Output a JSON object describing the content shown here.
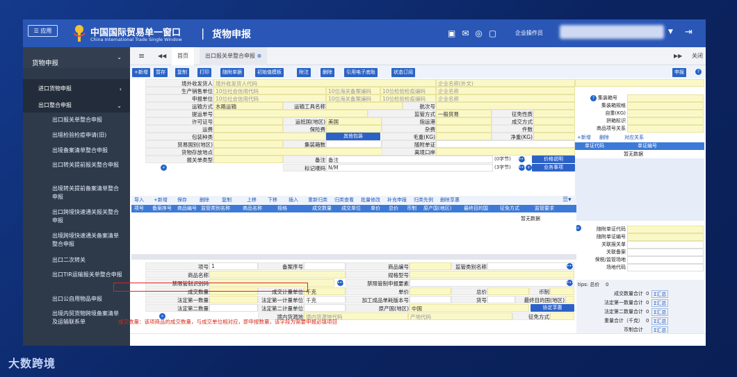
{
  "app": {
    "button": "应用",
    "title_cn": "中国国际贸易单一窗口",
    "title_en": "China International Trade Single Window",
    "module": "货物申报",
    "user_role": "企业操作员",
    "colors": {
      "header": "#2a57b6",
      "sidebar": "#2e3a4a",
      "field_yellow": "#fbf8c8",
      "accent_blue": "#2a63c6"
    }
  },
  "sidebar": {
    "top": "货物申报",
    "groups": [
      {
        "label": "进口货物申报"
      },
      {
        "label": "出口整合申报"
      }
    ],
    "items": [
      "出口报关单整合申报",
      "出境检验检疫申请(旧)",
      "出境备案清单整合申报",
      "出口转关提前报关整合申报",
      "出境转关提前备案清单整合申报",
      "出口跨境快速通关报关整合申报",
      "出境跨境快速通关备案清单整合申报",
      "出口二次转关",
      "出口TIR运输报关单整合申报",
      "出口公自用物品申报",
      "出境内贸货物跨境备案清单及运输联系单"
    ]
  },
  "tabs": {
    "home": "首页",
    "current": "出口报关单整合申报",
    "close_ops": "关闭操作"
  },
  "toolbar": [
    "+新增",
    "暂存",
    "复制",
    "打印",
    "随附单据",
    "初始值模板",
    "附注",
    "删除",
    "引用电子底账",
    "状态订阅"
  ],
  "declare": "申报",
  "form": {
    "rows": [
      [
        "境外收发货人",
        "境外收发货人代码",
        "",
        "企业名称(外文)"
      ],
      [
        "生产销售单位",
        "10位社会信用代码",
        "10位海关备案编码",
        "10位检验检疫编码",
        "企业名称"
      ],
      [
        "申报单位",
        "10位社会信用代码",
        "10位海关备案编码",
        "10位检验检疫编码",
        "企业名称"
      ]
    ],
    "labels": {
      "transport": "运输方式",
      "transport_val": "水路运输",
      "tool": "运输工具名称",
      "voyage": "航次号",
      "bill": "提运单号",
      "supervision": "监管方式",
      "supervision_val": "一般贸易",
      "levy": "征免性质",
      "license": "许可证号",
      "dest_country": "运抵国(地区)",
      "dest_country_val": "美国",
      "dest_port": "指运港",
      "deal": "成交方式",
      "freight": "运费",
      "insurance": "保险费",
      "misc": "杂费",
      "pieces": "件数",
      "pack": "包装种类",
      "other_pack": "其他包装",
      "gross": "毛重(KG)",
      "net": "净重(KG)",
      "trade_country": "贸易国别(地区)",
      "container": "集装箱数",
      "attached": "随附单证",
      "goods_place": "货物存放地点",
      "leave_port": "离境口岸",
      "decl_type": "报关单类型",
      "remark": "备注",
      "remark_ph": "备注",
      "mark": "标记唛码",
      "mark_val": "N/M",
      "bytes1": "(0字节)",
      "bytes2": "(3字节)",
      "price_desc": "价格说明",
      "business": "业务事项"
    }
  },
  "right": {
    "container_no": "集装箱号",
    "container_spec": "集装箱规格",
    "self_weight": "自重(KG)",
    "box_mark": "拼箱标识",
    "goods_rel": "商品项号关系",
    "add": "+新增",
    "del": "删除",
    "link": "对应关系",
    "col1": "单证代码",
    "col2": "单证编号",
    "nodata": "暂无数据",
    "doc_code": "随附单证代码",
    "doc_no": "随附单证编号",
    "related_decl": "关联报关单",
    "related_record": "关联备案",
    "bonded": "保税/监管场地",
    "yard": "场地代码",
    "tips_label": "tips: 总价",
    "tips_val": "0",
    "sums": [
      {
        "label": "成交数量合计",
        "val": "0",
        "btn": "Σ汇总"
      },
      {
        "label": "法定第一数量合计",
        "val": "0",
        "btn": "Σ汇总"
      },
      {
        "label": "法定第二数量合计",
        "val": "0",
        "btn": "Σ汇总"
      },
      {
        "label": "重量合计（千克）",
        "val": "0",
        "btn": "Σ汇总"
      },
      {
        "label": "币制合计",
        "val": "",
        "btn": "Σ汇总"
      }
    ]
  },
  "grid": {
    "toolbar": [
      "导入",
      "+新增",
      "保存",
      "删除",
      "复制",
      "上移",
      "下移",
      "插入",
      "重新归类",
      "归类查看",
      "批量修改",
      "补充申报",
      "归类先例",
      "删除享惠"
    ],
    "headers": [
      "项号",
      "备案序号",
      "商品编号",
      "监管类别名称",
      "商品名称",
      "规格",
      "成交数量",
      "成交单位",
      "单价",
      "总价",
      "币制",
      "原产国(地区)",
      "最终目的国",
      "征免方式",
      "监管要求"
    ],
    "nodata": "暂无数据"
  },
  "bottom": {
    "item_no": "项号",
    "item_no_val": "1",
    "record_no": "备案序号",
    "goods_code": "商品编号",
    "sup_cat": "监管类别名称",
    "goods_name": "商品名称",
    "spec": "规格型号",
    "forbid": "禁限管制识别码",
    "forbid_elem": "禁限管制申报要素",
    "deal_qty": "成交数量",
    "deal_unit": "成交计量单位",
    "deal_unit_val": "千克",
    "price": "单价",
    "total": "总价",
    "currency": "币制",
    "qty1": "法定第一数量",
    "unit1": "法定第一计量单位",
    "unit1_val": "千克",
    "process_ver": "加工成品单耗版本号",
    "goods_no": "货号",
    "final_country": "最终目的国(地区)",
    "qty2": "法定第二数量",
    "unit2": "法定第二计量单位",
    "origin": "原产国(地区)",
    "origin_val": "中国",
    "agreement": "协定享惠",
    "src_place": "境内货源地",
    "src_ph": "境内货源地代码",
    "place_ph": "产地代码",
    "levy": "征免方式"
  },
  "notice": "成交数量：该项商品的成交数量，与成交单位相对应，即申报数量，该字段为需要申报必填项目",
  "watermark": "大数跨境"
}
